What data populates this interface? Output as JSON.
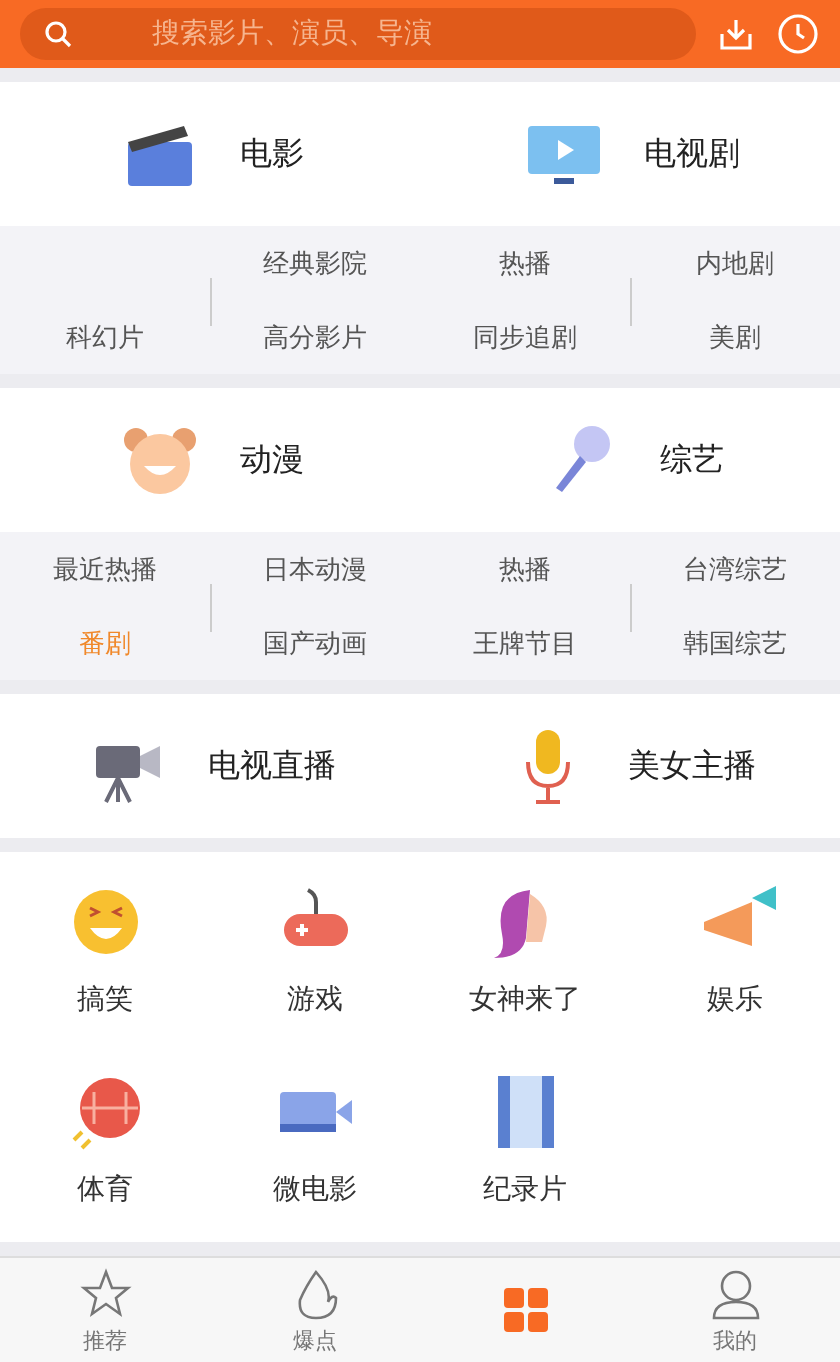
{
  "search": {
    "placeholder": "搜索影片、演员、导演"
  },
  "sections": [
    {
      "categories": [
        {
          "label": "电影"
        },
        {
          "label": "电视剧"
        }
      ],
      "links": [
        {
          "label": "经典影院",
          "selected": false
        },
        {
          "label": "热播",
          "selected": false
        },
        {
          "label": "内地剧",
          "selected": false
        },
        {
          "label": "科幻片",
          "selected": false
        },
        {
          "label": "高分影片",
          "selected": false
        },
        {
          "label": "同步追剧",
          "selected": false
        },
        {
          "label": "美剧",
          "selected": false
        }
      ]
    },
    {
      "categories": [
        {
          "label": "动漫"
        },
        {
          "label": "综艺"
        }
      ],
      "links": [
        {
          "label": "最近热播",
          "selected": false
        },
        {
          "label": "日本动漫",
          "selected": false
        },
        {
          "label": "热播",
          "selected": false
        },
        {
          "label": "台湾综艺",
          "selected": false
        },
        {
          "label": "番剧",
          "selected": true
        },
        {
          "label": "国产动画",
          "selected": false
        },
        {
          "label": "王牌节目",
          "selected": false
        },
        {
          "label": "韩国综艺",
          "selected": false
        }
      ]
    }
  ],
  "live": [
    {
      "label": "电视直播"
    },
    {
      "label": "美女主播"
    }
  ],
  "channels": [
    {
      "label": "搞笑"
    },
    {
      "label": "游戏"
    },
    {
      "label": "女神来了"
    },
    {
      "label": "娱乐"
    },
    {
      "label": "体育"
    },
    {
      "label": "微电影"
    },
    {
      "label": "纪录片"
    }
  ],
  "tabs": [
    {
      "label": "推荐",
      "selected": false
    },
    {
      "label": "爆点",
      "selected": false
    },
    {
      "selected": true
    },
    {
      "label": "我的",
      "selected": false
    }
  ]
}
